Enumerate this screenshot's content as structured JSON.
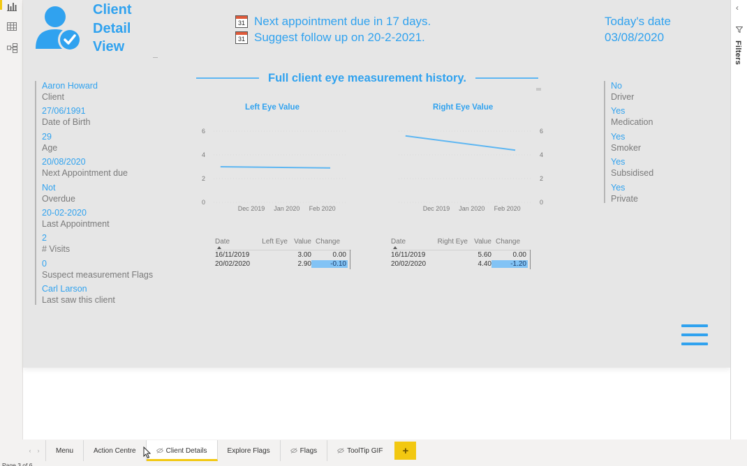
{
  "header": {
    "title_lines": [
      "Client",
      "Detail",
      "View"
    ],
    "notices": [
      {
        "icon": "calendar-icon",
        "day": "31",
        "text": "Next appointment due in 17 days."
      },
      {
        "icon": "calendar-icon",
        "day": "31",
        "text": "Suggest follow up on 20-2-2021."
      }
    ],
    "today_label": "Today's date",
    "today_value": "03/08/2020"
  },
  "client_details": [
    {
      "value": "Aaron Howard",
      "label": "Client"
    },
    {
      "value": "27/06/1991",
      "label": "Date of Birth"
    },
    {
      "value": "29",
      "label": "Age"
    },
    {
      "value": "20/08/2020",
      "label": "Next Appointment due"
    },
    {
      "value": "Not",
      "label": "Overdue"
    },
    {
      "value": "20-02-2020",
      "label": "Last Appointment"
    },
    {
      "value": "2",
      "label": "# Visits"
    },
    {
      "value": "0",
      "label": "Suspect measurement Flags"
    },
    {
      "value": "Carl Larson",
      "label": "Last saw this client"
    }
  ],
  "client_flags": [
    {
      "value": "No",
      "label": "Driver"
    },
    {
      "value": "Yes",
      "label": "Medication"
    },
    {
      "value": "Yes",
      "label": "Smoker"
    },
    {
      "value": "Yes",
      "label": "Subsidised"
    },
    {
      "value": "Yes",
      "label": "Private"
    }
  ],
  "section_title": "Full client eye measurement history.",
  "chart_data": [
    {
      "type": "line",
      "title": "Left Eye Value",
      "x": [
        "16/11/2019",
        "20/02/2020"
      ],
      "series": [
        {
          "name": "Left Eye Value",
          "values": [
            3.0,
            2.9
          ]
        }
      ],
      "xticks": [
        "Dec 2019",
        "Jan 2020",
        "Feb 2020"
      ],
      "yticks": [
        "0",
        "2",
        "4",
        "6"
      ],
      "ylim": [
        0,
        6
      ],
      "yaxis_side": "left",
      "grid": true,
      "color": "#5db6f2"
    },
    {
      "type": "line",
      "title": "Right Eye Value",
      "x": [
        "16/11/2019",
        "20/02/2020"
      ],
      "series": [
        {
          "name": "Right Eye Value",
          "values": [
            5.6,
            4.4
          ]
        }
      ],
      "xticks": [
        "Dec 2019",
        "Jan 2020",
        "Feb 2020"
      ],
      "yticks": [
        "0",
        "2",
        "4",
        "6"
      ],
      "ylim": [
        0,
        6
      ],
      "yaxis_side": "right",
      "grid": true,
      "color": "#5db6f2"
    }
  ],
  "tables": {
    "left": {
      "headers": [
        "Date",
        "Left Eye",
        "Value",
        "Change"
      ],
      "rows": [
        {
          "date": "16/11/2019",
          "value": "3.00",
          "change": "0.00",
          "highlight": false
        },
        {
          "date": "20/02/2020",
          "value": "2.90",
          "change": "-0.10",
          "highlight": true
        }
      ]
    },
    "right": {
      "headers": [
        "Date",
        "Right Eye",
        "Value",
        "Change"
      ],
      "rows": [
        {
          "date": "16/11/2019",
          "value": "5.60",
          "change": "0.00",
          "highlight": false
        },
        {
          "date": "20/02/2020",
          "value": "4.40",
          "change": "-1.20",
          "highlight": true
        }
      ]
    }
  },
  "filters_pane": {
    "label": "Filters"
  },
  "page_tabs": {
    "items": [
      {
        "label": "Menu",
        "hidden": false,
        "active": false
      },
      {
        "label": "Action Centre",
        "hidden": false,
        "active": false
      },
      {
        "label": "Client Details",
        "hidden": true,
        "active": true
      },
      {
        "label": "Explore Flags",
        "hidden": false,
        "active": false
      },
      {
        "label": "Flags",
        "hidden": true,
        "active": false
      },
      {
        "label": "ToolTip GIF",
        "hidden": true,
        "active": false
      }
    ],
    "add_label": "+",
    "status": "Page 3 of 6"
  },
  "colors": {
    "accent": "#30a2ef",
    "tab_active": "#f2c811",
    "highlight": "#82c3f5"
  }
}
